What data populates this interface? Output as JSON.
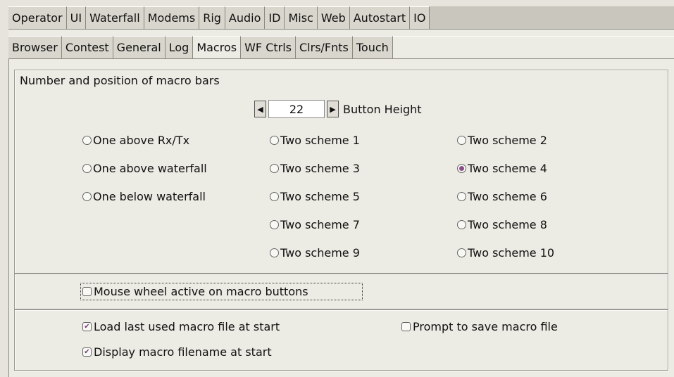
{
  "tabs_top": [
    "Operator",
    "UI",
    "Waterfall",
    "Modems",
    "Rig",
    "Audio",
    "ID",
    "Misc",
    "Web",
    "Autostart",
    "IO"
  ],
  "tabs_top_active": "UI",
  "tabs_sub": [
    "Browser",
    "Contest",
    "General",
    "Log",
    "Macros",
    "WF Ctrls",
    "Clrs/Fnts",
    "Touch"
  ],
  "tabs_sub_active": "Macros",
  "group1": {
    "label": "Number and position of macro bars",
    "spinner": {
      "value": "22",
      "label": "Button Height"
    },
    "radios": [
      "One above Rx/Tx",
      "One above waterfall",
      "One below waterfall",
      "Two scheme 1",
      "Two scheme 3",
      "Two scheme 5",
      "Two scheme 7",
      "Two scheme 9",
      "Two scheme 2",
      "Two scheme 4",
      "Two scheme 6",
      "Two scheme 8",
      "Two scheme 10"
    ],
    "selected": "Two scheme 4"
  },
  "group2": {
    "mouse_wheel": {
      "label": "Mouse wheel active on macro buttons",
      "checked": false
    }
  },
  "group3": {
    "load_last": {
      "label": "Load last used macro file at start",
      "checked": true
    },
    "prompt_save": {
      "label": "Prompt to save macro file",
      "checked": false
    },
    "display_name": {
      "label": "Display macro filename at start",
      "checked": true
    }
  },
  "icons": {
    "left": "arrow-left-icon",
    "right": "arrow-right-icon",
    "check": "check-icon"
  },
  "colors": {
    "radio_selected": "#8a4f8a",
    "background": "#ecebe4"
  }
}
